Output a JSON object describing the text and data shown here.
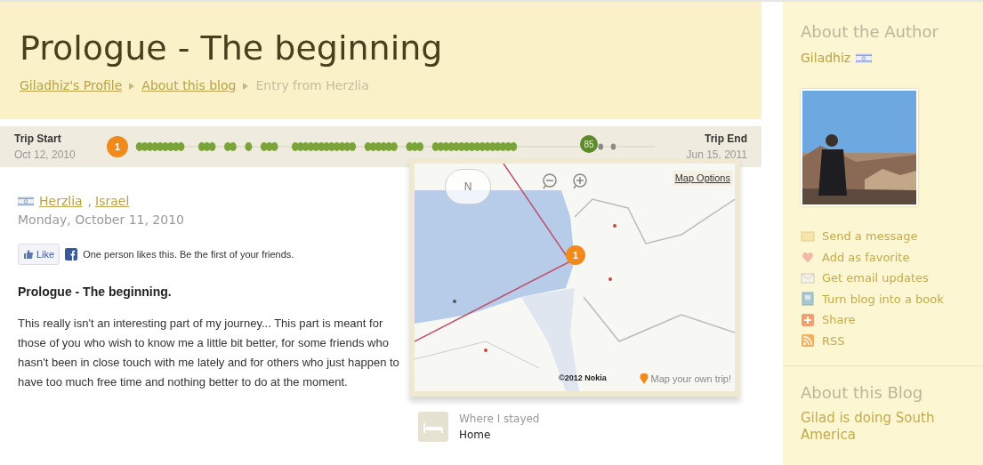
{
  "header": {
    "title": "Prologue - The beginning",
    "breadcrumbs": [
      {
        "label": "Giladhiz's Profile",
        "kind": "link"
      },
      {
        "label": "About this blog",
        "kind": "link"
      },
      {
        "label": "Entry from Herzlia",
        "kind": "current"
      }
    ]
  },
  "timeline": {
    "start_label": "Trip Start",
    "start_date": "Oct 12, 2010",
    "marker": "1",
    "count": "85",
    "end_label": "Trip End",
    "end_date": "Jun 15, 2011"
  },
  "entry": {
    "location": [
      {
        "label": "Herzlia"
      },
      {
        "label": "Israel"
      }
    ],
    "separator": ",",
    "date": "Monday, October 11, 2010",
    "like_button": "Like",
    "like_text": "One person likes this. Be the first of your friends.",
    "heading": "Prologue - The beginning.",
    "body": "This really isn't an interesting part of my journey... This part is meant for those of you who wish to know me a little bit better, for some friends who hasn't been in close touch with me lately and for others who just happen to have too much free time and nothing better to do at the moment."
  },
  "map": {
    "compass": "N",
    "options": "Map Options",
    "marker": "1",
    "copyright": "©2012 Nokia",
    "own_trip": "Map your own trip!"
  },
  "stay": {
    "label": "Where I stayed",
    "value": "Home"
  },
  "sidebar": {
    "author_title": "About the Author",
    "author": "Giladhiz",
    "actions": [
      {
        "label": "Send a message",
        "kind": "message"
      },
      {
        "label": "Add as favorite",
        "kind": "favorite"
      },
      {
        "label": "Get email updates",
        "kind": "email"
      },
      {
        "label": "Turn blog into a book",
        "kind": "book"
      },
      {
        "label": "Share",
        "kind": "share"
      },
      {
        "label": "RSS",
        "kind": "rss"
      }
    ],
    "blog_title": "About this Blog",
    "blog_text": "Gilad is doing South America"
  }
}
